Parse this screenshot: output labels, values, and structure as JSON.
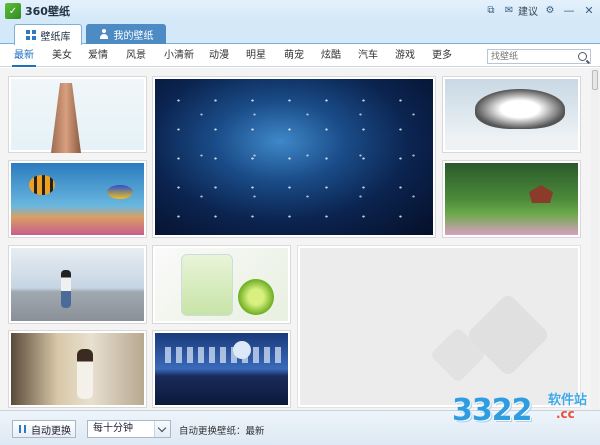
{
  "app": {
    "title": "360壁纸"
  },
  "title_controls": {
    "suggest_label": "建议"
  },
  "tabs": [
    {
      "label": "壁纸库"
    },
    {
      "label": "我的壁纸"
    }
  ],
  "categories": [
    "最新",
    "美女",
    "爱情",
    "风景",
    "小清新",
    "动漫",
    "明星",
    "萌宠",
    "炫酷",
    "汽车",
    "游戏",
    "更多"
  ],
  "search": {
    "placeholder": "找壁纸"
  },
  "thumbnails": [
    {
      "name": "candy-tower"
    },
    {
      "name": "tropical-fish"
    },
    {
      "name": "starry-space"
    },
    {
      "name": "snow-tree"
    },
    {
      "name": "chinese-garden"
    },
    {
      "name": "girl-on-road"
    },
    {
      "name": "lime-drink"
    },
    {
      "name": "girl-window"
    },
    {
      "name": "city-night"
    },
    {
      "name": "placeholder"
    }
  ],
  "bottom": {
    "auto_change_label": "自动更换",
    "interval_value": "每十分钟",
    "status": "自动更换壁纸：最新"
  },
  "watermark": {
    "number": "3322",
    "site": "软件站",
    "domain": ".cc"
  }
}
